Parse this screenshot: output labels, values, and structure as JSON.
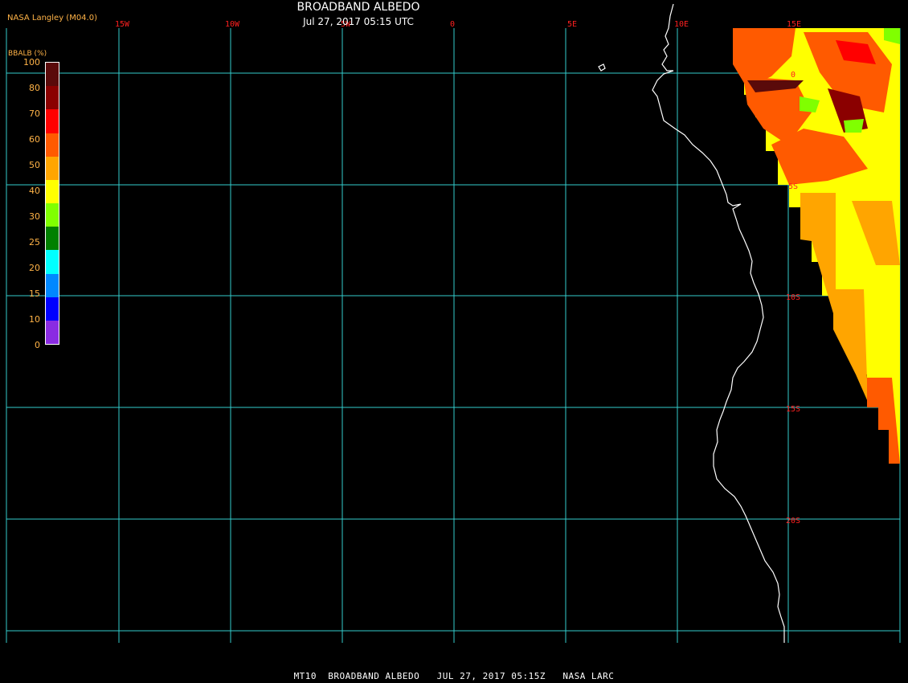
{
  "header": {
    "title": "BROADBAND ALBEDO",
    "subtitle": "Jul 27, 2017 05:15 UTC",
    "credit": "NASA Langley (M04.0)"
  },
  "legend": {
    "title": "BBALB (%)",
    "labels": [
      "100",
      "80",
      "70",
      "60",
      "50",
      "40",
      "30",
      "25",
      "20",
      "15",
      "10",
      "0"
    ],
    "colors": [
      "#5a0a0a",
      "#8b0000",
      "#ff0000",
      "#ff5a00",
      "#ffa500",
      "#ffff00",
      "#80ff00",
      "#008000",
      "#00ffff",
      "#0088ff",
      "#0000ff",
      "#8a2be2"
    ]
  },
  "map": {
    "longitude_labels": [
      "15W",
      "10W",
      "5W",
      "0",
      "5E",
      "10E",
      "15E"
    ],
    "latitude_labels": [
      "0",
      "5S",
      "10S",
      "15S",
      "20S"
    ],
    "grid_color": "#33cccc",
    "coastline_color": "#ffffff",
    "label_color": "#ff2020"
  },
  "footer": {
    "text": "MT10  BROADBAND ALBEDO   JUL 27, 2017 05:15Z   NASA LARC"
  }
}
